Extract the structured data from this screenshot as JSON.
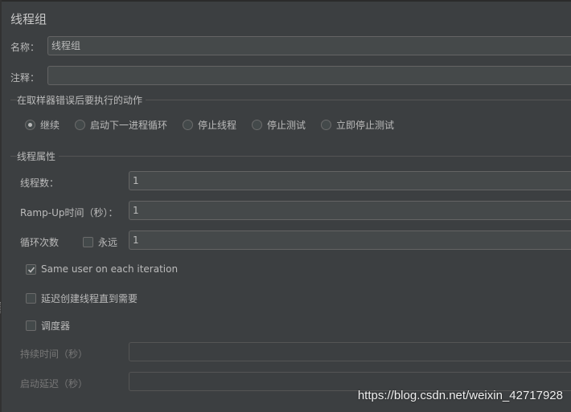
{
  "title": "线程组",
  "name_field": {
    "label": "名称：",
    "value": "线程组"
  },
  "comment_field": {
    "label": "注释：",
    "value": ""
  },
  "sampler_error_action": {
    "title": "在取样器错误后要执行的动作",
    "options": [
      "继续",
      "启动下一进程循环",
      "停止线程",
      "停止测试",
      "立即停止测试"
    ],
    "selected": "继续"
  },
  "thread_properties": {
    "title": "线程属性",
    "thread_count": {
      "label": "线程数：",
      "value": "1"
    },
    "ramp_up": {
      "label": "Ramp-Up时间（秒）：",
      "value": "1"
    },
    "loop_count": {
      "label": "循环次数",
      "forever_label": "永远",
      "forever_checked": false,
      "value": "1"
    },
    "same_user": {
      "label": "Same user on each iteration",
      "checked": true
    },
    "delay_thread_creation": {
      "label": "延迟创建线程直到需要",
      "checked": false
    },
    "scheduler": {
      "label": "调度器",
      "checked": false
    },
    "duration": {
      "label": "持续时间（秒）",
      "value": ""
    },
    "startup_delay": {
      "label": "启动延迟（秒）",
      "value": ""
    }
  },
  "watermark": "https://blog.csdn.net/weixin_42717928",
  "colors": {
    "background": "#3c3f41",
    "field": "#45494a",
    "text": "#bbbbbb",
    "disabled_text": "#777777"
  }
}
